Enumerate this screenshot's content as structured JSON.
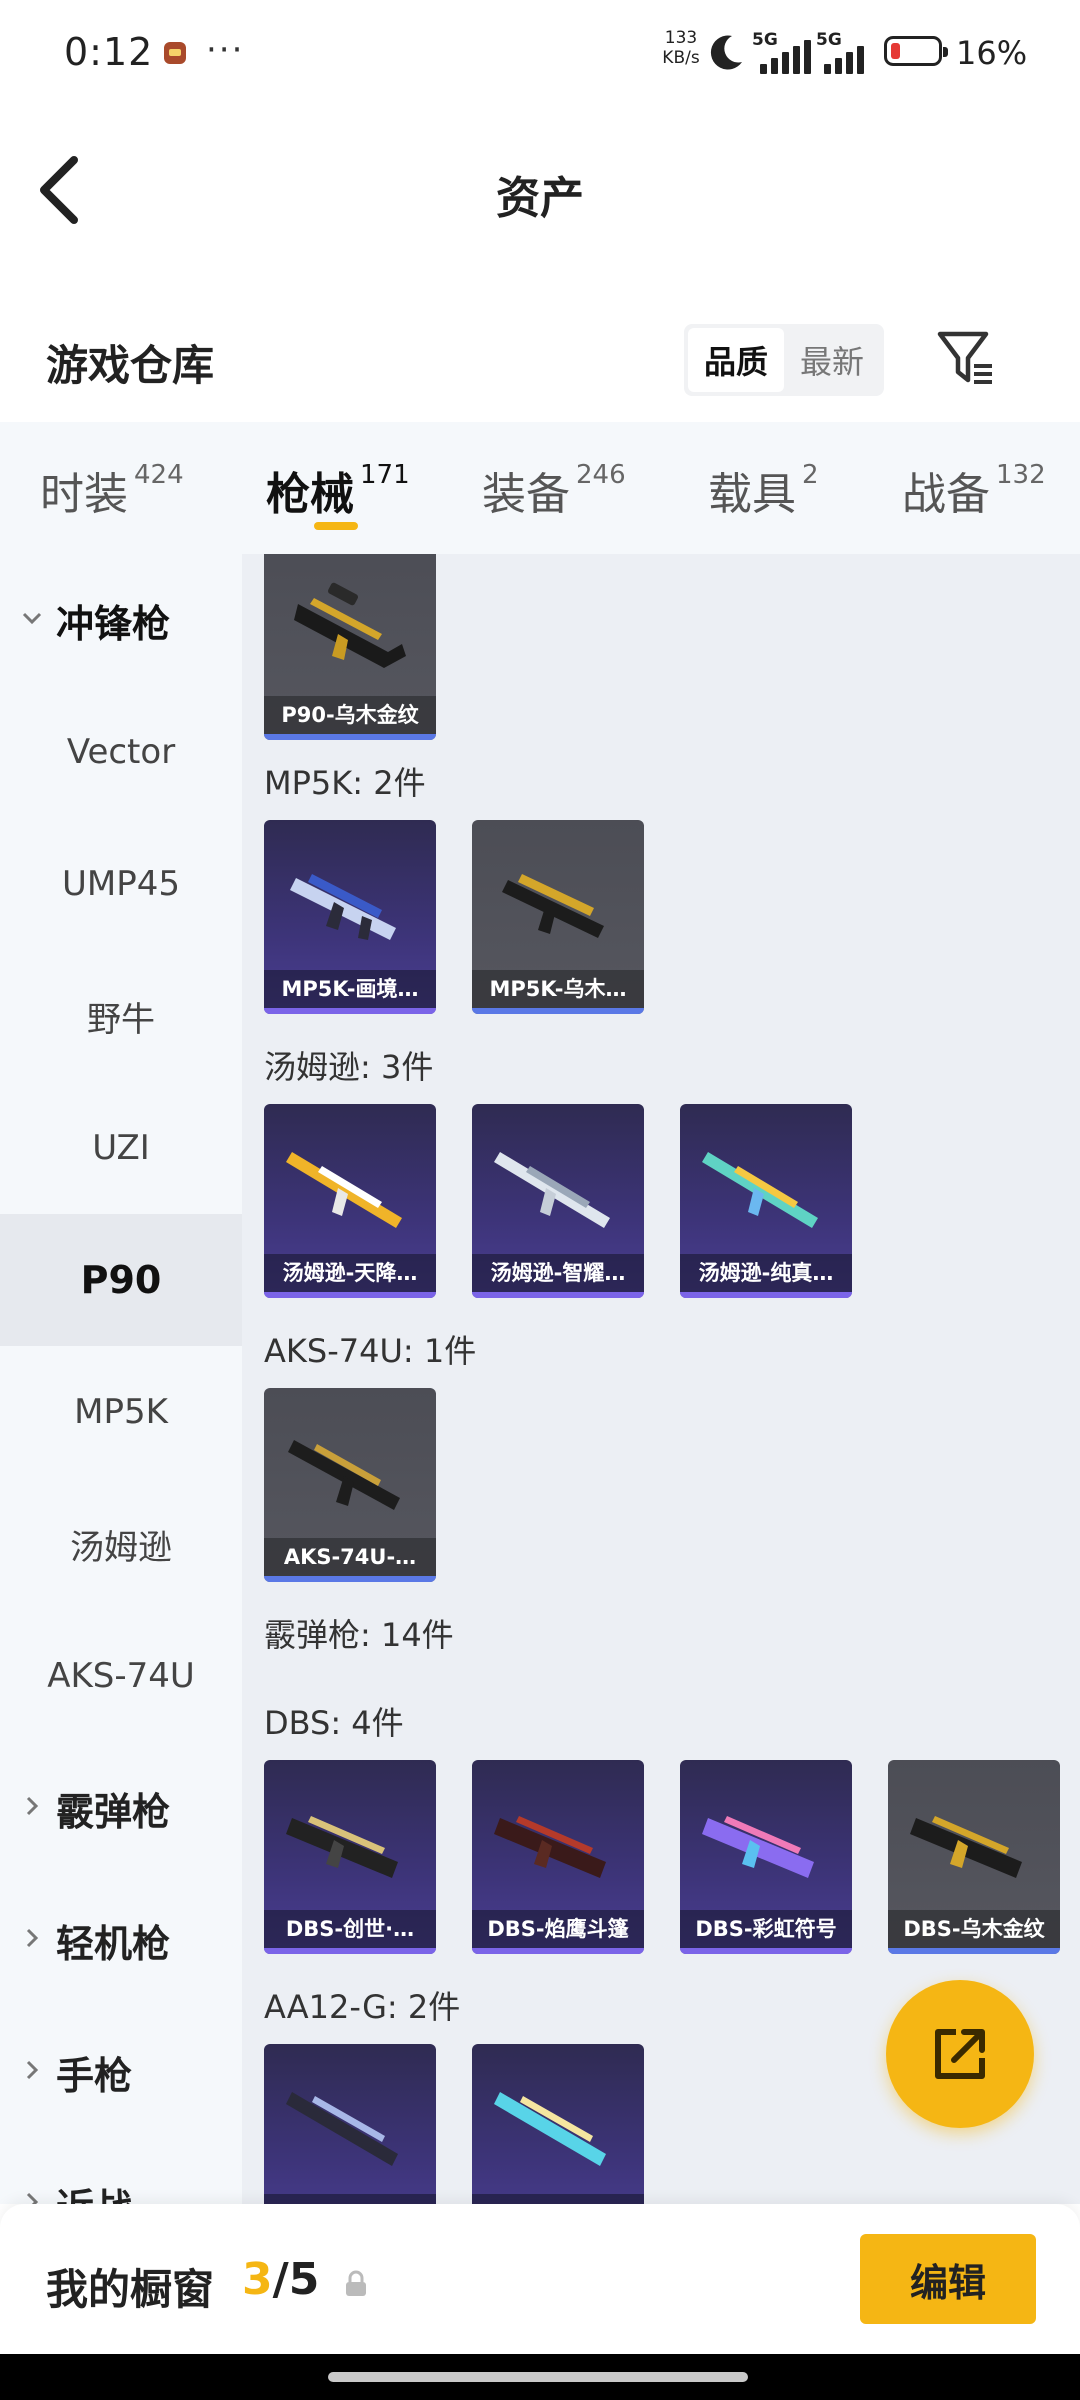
{
  "status_bar": {
    "time": "0:12",
    "dots": "···",
    "net_speed_value": "133",
    "net_speed_unit": "KB/s",
    "signal1_gen": "5G",
    "signal2_gen": "5G",
    "battery_percent": "16%",
    "battery_level": 0.16,
    "battery_color": "#e53935"
  },
  "header": {
    "title": "资产",
    "back_icon": "chevron-left-icon"
  },
  "warehouse": {
    "title": "游戏仓库",
    "sort_options": [
      "品质",
      "最新"
    ],
    "sort_selected": "品质",
    "filter_icon": "filter-icon"
  },
  "tabs": [
    {
      "label": "时装",
      "count": "424"
    },
    {
      "label": "枪械",
      "count": "171",
      "active": true
    },
    {
      "label": "装备",
      "count": "246"
    },
    {
      "label": "载具",
      "count": "2"
    },
    {
      "label": "战备",
      "count": "132"
    }
  ],
  "sidebar": {
    "items": [
      {
        "label": "冲锋枪",
        "type": "category",
        "expanded": true
      },
      {
        "label": "Vector",
        "type": "sub"
      },
      {
        "label": "UMP45",
        "type": "sub"
      },
      {
        "label": "野牛",
        "type": "sub"
      },
      {
        "label": "UZI",
        "type": "sub"
      },
      {
        "label": "P90",
        "type": "sub",
        "selected": true
      },
      {
        "label": "MP5K",
        "type": "sub"
      },
      {
        "label": "汤姆逊",
        "type": "sub"
      },
      {
        "label": "AKS-74U",
        "type": "sub"
      },
      {
        "label": "霰弹枪",
        "type": "category"
      },
      {
        "label": "轻机枪",
        "type": "category"
      },
      {
        "label": "手枪",
        "type": "category"
      },
      {
        "label": "近战",
        "type": "category"
      }
    ]
  },
  "content": {
    "groups": [
      {
        "title": "",
        "items": [
          {
            "label": "P90-乌木金纹",
            "style": "grey"
          }
        ]
      },
      {
        "title": "MP5K: 2件",
        "items": [
          {
            "label": "MP5K-画境…",
            "style": "purple"
          },
          {
            "label": "MP5K-乌木…",
            "style": "grey"
          }
        ]
      },
      {
        "title": "汤姆逊: 3件",
        "items": [
          {
            "label": "汤姆逊-天降…",
            "style": "purple"
          },
          {
            "label": "汤姆逊-智耀…",
            "style": "purple"
          },
          {
            "label": "汤姆逊-纯真…",
            "style": "purple"
          }
        ]
      },
      {
        "title": "AKS-74U: 1件",
        "items": [
          {
            "label": "AKS-74U-…",
            "style": "grey"
          }
        ]
      },
      {
        "title": "霰弹枪: 14件",
        "items": []
      },
      {
        "title": "DBS: 4件",
        "items": [
          {
            "label": "DBS-创世·…",
            "style": "purple"
          },
          {
            "label": "DBS-焰鹰斗篷",
            "style": "purple"
          },
          {
            "label": "DBS-彩虹符号",
            "style": "purple"
          },
          {
            "label": "DBS-乌木金纹",
            "style": "grey"
          }
        ]
      },
      {
        "title": "AA12-G: 2件",
        "items": [
          {
            "label": "",
            "style": "purple"
          },
          {
            "label": "",
            "style": "purple"
          }
        ]
      }
    ]
  },
  "fab": {
    "icon": "share-icon",
    "color": "#f5b614"
  },
  "bottom_bar": {
    "title": "我的橱窗",
    "current": "3",
    "separator": "/",
    "total": "5",
    "lock_icon": "lock-icon",
    "edit_label": "编辑",
    "accent": "#f5b614"
  }
}
